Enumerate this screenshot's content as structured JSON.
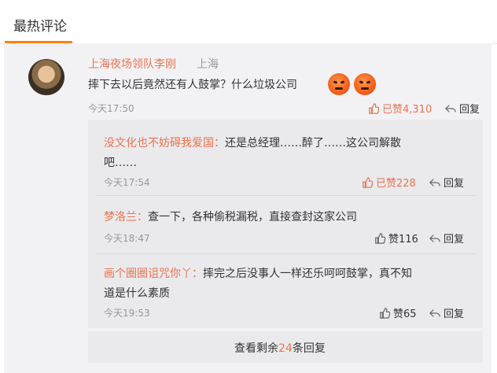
{
  "section": {
    "title": "最热评论"
  },
  "main_comment": {
    "username": "上海夜场领队李刚",
    "location": "上海",
    "text": "摔下去以后竟然还有人鼓掌？什么垃圾公司",
    "emoji": "angry-face-icon",
    "time": "今天17:50",
    "like_label": "已赞4,310",
    "reply_label": "回复"
  },
  "replies": [
    {
      "username": "没文化也不妨碍我爱国：",
      "text_line1": "还是总经理……醉了……这公司解散",
      "text_line2": "吧……",
      "time": "今天17:54",
      "like_label": "已赞228",
      "reply_label": "回复"
    },
    {
      "username": "梦洛兰：",
      "text": "查一下，各种偷税漏税，直接查封这家公司",
      "time": "今天18:47",
      "like_label": "赞116",
      "reply_label": "回复"
    },
    {
      "username": "画个圈圈诅咒你丫：",
      "text_line1": "摔完之后没事人一样还乐呵呵鼓掌，真不知",
      "text_line2": "道是什么素质",
      "time": "今天19:53",
      "like_label": "赞65",
      "reply_label": "回复"
    }
  ],
  "more": {
    "prefix": "查看剩余",
    "count": "24",
    "suffix": "条回复"
  },
  "colors": {
    "accent": "#ff8200",
    "username": "#eb7350",
    "muted": "#999999",
    "panel": "#f2f2f5"
  }
}
